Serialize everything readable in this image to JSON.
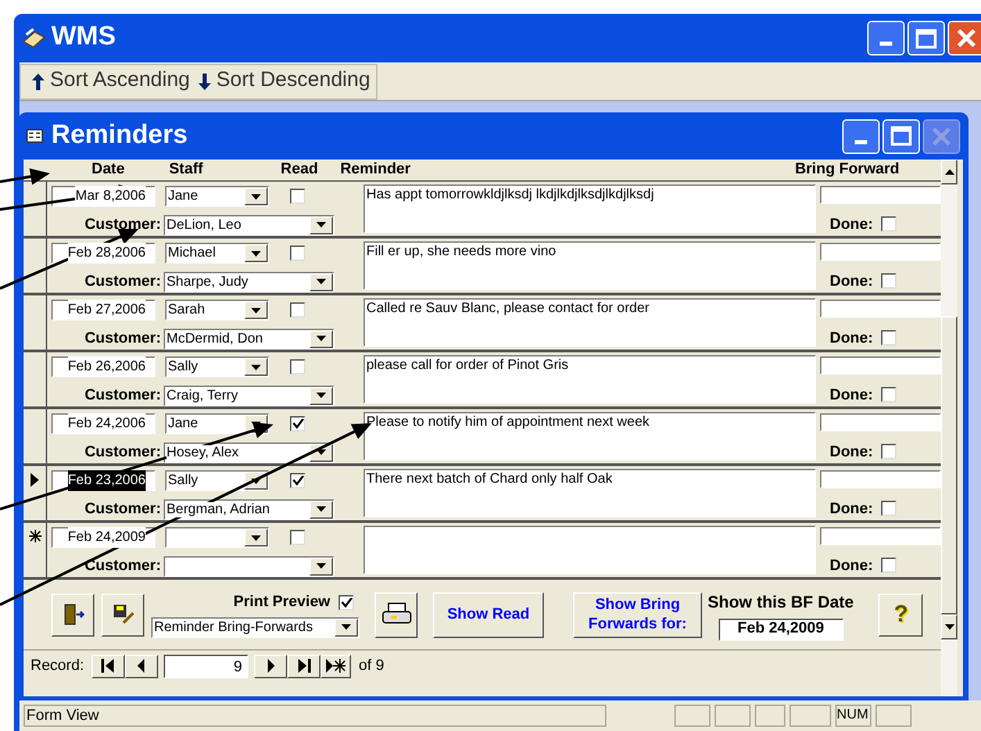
{
  "window": {
    "title": "WMS"
  },
  "toolbar": [
    {
      "kind": "up",
      "label": "Sort Ascending"
    },
    {
      "kind": "down",
      "label": "Sort Descending"
    }
  ],
  "form": {
    "title": "Reminders",
    "columns": {
      "date": "Date",
      "staff": "Staff",
      "read": "Read",
      "reminder": "Reminder",
      "bring_forward": "Bring Forward"
    },
    "rows": [
      {
        "kind": "plain",
        "date": "Mar 8,2006",
        "date_selected": false,
        "staff": "Jane",
        "read": false,
        "customer_label": "Customer:",
        "customer": "DeLion, Leo",
        "reminder": "Has appt tomorrowkldjlksdj lkdjlkdjlksdjlkdjlksdj",
        "done_label": "Done:",
        "done": false
      },
      {
        "kind": "plain",
        "date": "Feb 28,2006",
        "date_selected": false,
        "staff": "Michael",
        "read": false,
        "customer_label": "Customer:",
        "customer": "Sharpe, Judy",
        "reminder": "Fill er up, she needs more vino",
        "done_label": "Done:",
        "done": false
      },
      {
        "kind": "plain",
        "date": "Feb 27,2006",
        "date_selected": false,
        "staff": "Sarah",
        "read": false,
        "customer_label": "Customer:",
        "customer": "McDermid, Don",
        "reminder": "Called re Sauv Blanc, please contact for order",
        "done_label": "Done:",
        "done": false
      },
      {
        "kind": "plain",
        "date": "Feb 26,2006",
        "date_selected": false,
        "staff": "Sally",
        "read": false,
        "customer_label": "Customer:",
        "customer": "Craig, Terry",
        "reminder": "please call for order of Pinot Gris",
        "done_label": "Done:",
        "done": false
      },
      {
        "kind": "plain",
        "date": "Feb 24,2006",
        "date_selected": false,
        "staff": "Jane",
        "read": true,
        "customer_label": "Customer:",
        "customer": "Hosey, Alex",
        "reminder": "Please to notify him of appointment next week",
        "done_label": "Done:",
        "done": false
      },
      {
        "kind": "current",
        "date": "Feb 23,2006",
        "date_selected": true,
        "staff": "Sally",
        "read": true,
        "customer_label": "Customer:",
        "customer": "Bergman, Adrian",
        "reminder": "There next batch of Chard only half Oak",
        "done_label": "Done:",
        "done": false
      },
      {
        "kind": "new",
        "date": "Feb 24,2009",
        "date_selected": false,
        "read": false,
        "customer_label": "Customer:",
        "done_label": "Done:",
        "done": false
      }
    ],
    "print_preview": {
      "label": "Print Preview",
      "checked": true
    },
    "report": "Reminder Bring-Forwards",
    "show_read": "Show Read",
    "show_bring_forwards": "Show Bring Forwards for:",
    "bf_date_label": "Show this BF Date",
    "bf_date": "Feb 24,2009",
    "help": "?",
    "navigation": {
      "label": "Record:",
      "current": "9",
      "total": "of 9"
    }
  },
  "status_bar": {
    "text": "Form View",
    "num": "NUM"
  }
}
